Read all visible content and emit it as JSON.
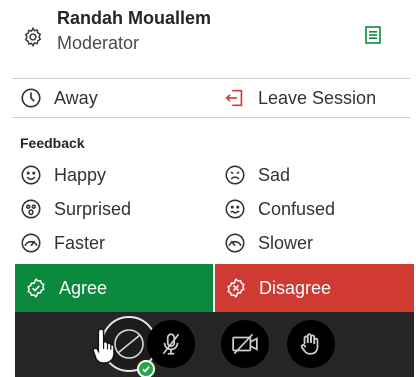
{
  "header": {
    "user_name": "Randah Mouallem",
    "user_role": "Moderator",
    "settings_icon": "gear-icon",
    "notes_icon": "list-icon",
    "accent": "#0b8a3e"
  },
  "status_actions": {
    "away_label": "Away",
    "leave_label": "Leave Session",
    "leave_icon_color": "#cf3a33"
  },
  "feedback": {
    "section_label": "Feedback",
    "items": [
      {
        "label": "Happy",
        "icon": "happy-face-icon"
      },
      {
        "label": "Sad",
        "icon": "sad-face-icon"
      },
      {
        "label": "Surprised",
        "icon": "surprised-face-icon"
      },
      {
        "label": "Confused",
        "icon": "confused-face-icon"
      },
      {
        "label": "Faster",
        "icon": "faster-icon"
      },
      {
        "label": "Slower",
        "icon": "slower-icon"
      }
    ],
    "agree_label": "Agree",
    "disagree_label": "Disagree",
    "agree_color": "#0b8a3e",
    "disagree_color": "#cf3a33"
  },
  "controls": {
    "buttons": [
      {
        "name": "status-avatar-button",
        "icon": "avatar-icon"
      },
      {
        "name": "microphone-button",
        "icon": "microphone-off-icon"
      },
      {
        "name": "camera-button",
        "icon": "camera-off-icon"
      },
      {
        "name": "raise-hand-button",
        "icon": "hand-icon"
      }
    ],
    "status_color": "#27a844"
  }
}
